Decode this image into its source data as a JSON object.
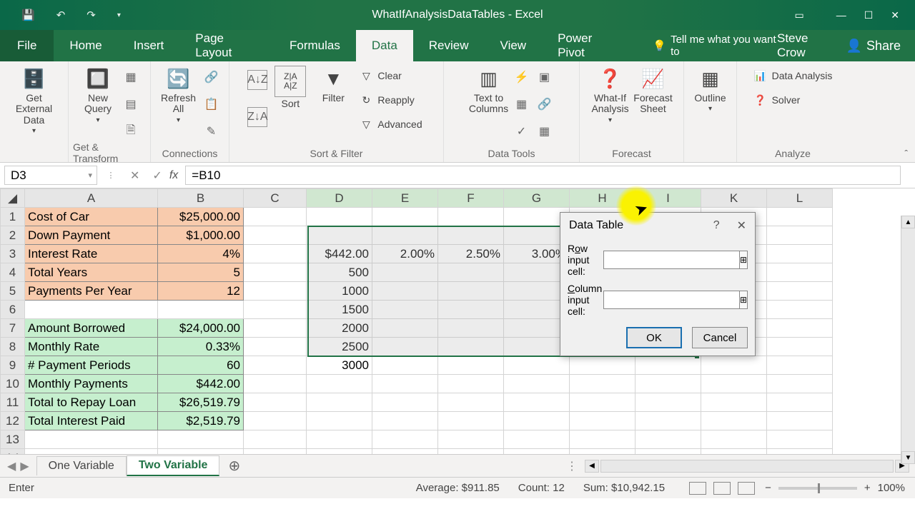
{
  "app": {
    "title": "WhatIfAnalysisDataTables - Excel"
  },
  "tabs": {
    "file": "File",
    "home": "Home",
    "insert": "Insert",
    "pageLayout": "Page Layout",
    "formulas": "Formulas",
    "data": "Data",
    "review": "Review",
    "view": "View",
    "powerPivot": "Power Pivot",
    "tell": "Tell me what you want to",
    "user": "Steve Crow",
    "share": "Share"
  },
  "ribbon": {
    "getExternalData": "Get External Data",
    "newQuery": "New Query",
    "refreshAll": "Refresh All",
    "getTransform": "Get & Transform",
    "connections": "Connections",
    "sort": "Sort",
    "filter": "Filter",
    "clear": "Clear",
    "reapply": "Reapply",
    "advanced": "Advanced",
    "sortFilter": "Sort & Filter",
    "textToColumns": "Text to Columns",
    "dataTools": "Data Tools",
    "whatIf": "What-If Analysis",
    "forecastSheet": "Forecast Sheet",
    "forecast": "Forecast",
    "outline": "Outline",
    "dataAnalysis": "Data Analysis",
    "solver": "Solver",
    "analyze": "Analyze"
  },
  "formula_bar": {
    "name_box": "D3",
    "formula": "=B10"
  },
  "columns": [
    "A",
    "B",
    "C",
    "D",
    "E",
    "F",
    "G",
    "H",
    "I",
    "K",
    "L"
  ],
  "rows": [
    {
      "n": 1,
      "a": "Cost of Car",
      "b": "$25,000.00",
      "cls": "o"
    },
    {
      "n": 2,
      "a": "Down Payment",
      "b": "$1,000.00",
      "cls": "o"
    },
    {
      "n": 3,
      "a": "Interest Rate",
      "b": "4%",
      "cls": "o"
    },
    {
      "n": 4,
      "a": "Total Years",
      "b": "5",
      "cls": "o"
    },
    {
      "n": 5,
      "a": "Payments Per Year",
      "b": "12",
      "cls": "o"
    },
    {
      "n": 6,
      "a": "",
      "b": "",
      "cls": ""
    },
    {
      "n": 7,
      "a": "Amount Borrowed",
      "b": "$24,000.00",
      "cls": "g"
    },
    {
      "n": 8,
      "a": "Monthly Rate",
      "b": "0.33%",
      "cls": "g"
    },
    {
      "n": 9,
      "a": "# Payment Periods",
      "b": "60",
      "cls": "g"
    },
    {
      "n": 10,
      "a": "Monthly Payments",
      "b": "$442.00",
      "cls": "g"
    },
    {
      "n": 11,
      "a": "Total to Repay Loan",
      "b": "$26,519.79",
      "cls": "g"
    },
    {
      "n": 12,
      "a": "Total Interest Paid",
      "b": "$2,519.79",
      "cls": "g"
    },
    {
      "n": 13,
      "a": "",
      "b": "",
      "cls": ""
    }
  ],
  "table": {
    "header": [
      "$442.00",
      "2.00%",
      "2.50%",
      "3.00%"
    ],
    "col1": [
      "500",
      "1000",
      "1500",
      "2000",
      "2500",
      "3000"
    ]
  },
  "dialog": {
    "title": "Data Table",
    "rowLabelPre": "R",
    "rowLabelU": "o",
    "rowLabelPost": "w input cell:",
    "colLabelPre": "",
    "colLabelU": "C",
    "colLabelPost": "olumn input cell:",
    "rowVal": "",
    "colVal": "",
    "ok": "OK",
    "cancel": "Cancel"
  },
  "sheets": {
    "one": "One Variable",
    "two": "Two Variable"
  },
  "status": {
    "mode": "Enter",
    "avg": "Average: $911.85",
    "count": "Count: 12",
    "sum": "Sum: $10,942.15",
    "zoom": "100%"
  }
}
